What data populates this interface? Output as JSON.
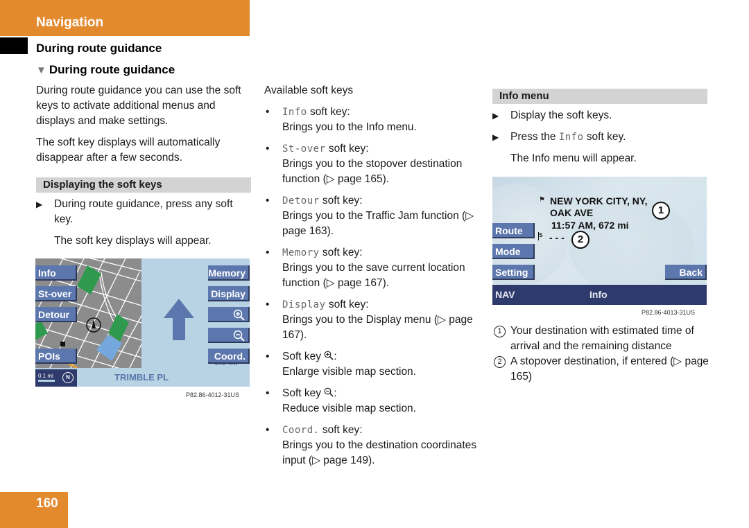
{
  "header": {
    "chapter": "Navigation",
    "section": "During route guidance",
    "subsection": "During route guidance"
  },
  "left_column": {
    "intro": "During route guidance you can use the soft keys to activate additional menus and displays and make settings.",
    "note": "The soft key displays will automatically disappear after a few seconds.",
    "box_heading": "Displaying the soft keys",
    "step": "During route guidance, press any soft key.",
    "result": "The soft key displays will appear.",
    "screen": {
      "left_keys": [
        "Info",
        "St-over",
        "Detour",
        "POIs"
      ],
      "right_keys": [
        "Memory",
        "Display",
        "zoom-in-icon",
        "zoom-out-icon",
        "Coord."
      ],
      "scale_label": "0.1 mi",
      "street": "TRIMBLE PL",
      "partial_distance": "0.0 mi",
      "colors": {
        "map": "#8c8c8c",
        "park": "#2f9a4d",
        "water": "#74a7dc",
        "softkey": "#5c77ad",
        "bar": "#2e3a6b"
      }
    },
    "caption": "P82.86-4012-31US"
  },
  "middle_column": {
    "heading": "Available soft keys",
    "items": [
      {
        "key": "Info",
        "suffix": " soft key:",
        "desc": "Brings you to the Info menu."
      },
      {
        "key": "St-over",
        "suffix": " soft key:",
        "desc": "Brings you to the stopover destination function (▷ page 165)."
      },
      {
        "key": "Detour",
        "suffix": " soft key:",
        "desc": "Brings you to the Traffic Jam function (▷ page 163)."
      },
      {
        "key": "Memory",
        "suffix": " soft key:",
        "desc": "Brings you to the save current location function (▷ page 167)."
      },
      {
        "key": "Display",
        "suffix": " soft key:",
        "desc": "Brings you to the Display menu (▷ page 167)."
      },
      {
        "key": "",
        "prefix": "Soft key ",
        "icon": "zoom-in-icon",
        "suffix": ":",
        "desc": "Enlarge visible map section."
      },
      {
        "key": "",
        "prefix": "Soft key ",
        "icon": "zoom-out-icon",
        "suffix": ":",
        "desc": "Reduce visible map section."
      },
      {
        "key": "Coord.",
        "suffix": " soft key:",
        "desc": "Brings you to the destination coordinates input (▷ page 149)."
      }
    ]
  },
  "right_column": {
    "box_heading": "Info menu",
    "steps": [
      "Display the soft keys.",
      "Press the "
    ],
    "step2_key": "Info",
    "step2_suffix": " soft key.",
    "result": "The Info menu will appear.",
    "screen": {
      "destination_line1": "NEW YORK CITY, NY,",
      "destination_line2": "OAK AVE",
      "eta_distance": "11:57 AM, 672 mi",
      "stopover": "- - -",
      "callouts": [
        "1",
        "2"
      ],
      "left_keys": [
        "Route",
        "Mode",
        "Setting"
      ],
      "right_key": "Back",
      "bar_left": "NAV",
      "bar_center": "Info"
    },
    "caption": "P82.86-4013-31US",
    "legend": [
      {
        "num": "1",
        "text": "Your destination with estimated time of arrival and the remaining distance"
      },
      {
        "num": "2",
        "text": "A stopover destination, if entered (▷ page 165)"
      }
    ]
  },
  "footer": {
    "page_number": "160"
  },
  "colors": {
    "accent": "#e38a2f",
    "heading_bar": "#d3d3d3"
  }
}
